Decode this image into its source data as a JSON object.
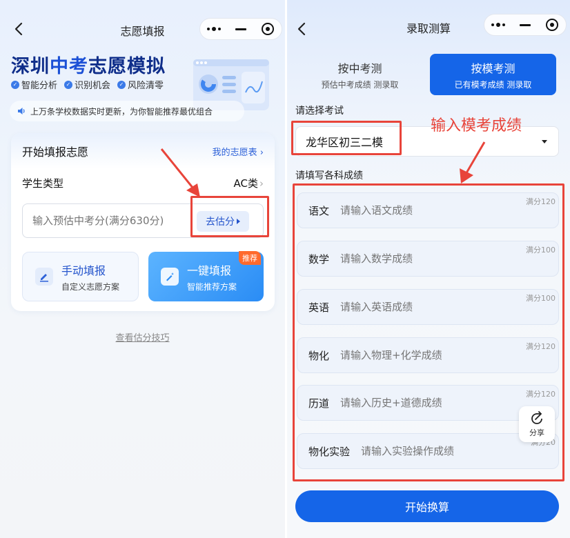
{
  "left": {
    "nav_title": "志愿填报",
    "hero": {
      "title_a": "深圳",
      "title_b": "中考",
      "title_c": "志愿模拟"
    },
    "features": [
      "智能分析",
      "识别机会",
      "风险清零"
    ],
    "notice": "上万条学校数据实时更新，为你智能推荐最优组合",
    "card": {
      "title": "开始填报志愿",
      "my_link": "我的志愿表",
      "student_type_label": "学生类型",
      "student_type_value": "AC类",
      "score_placeholder": "输入预估中考分(满分630分)",
      "estimate_button": "去估分",
      "manual": {
        "title": "手动填报",
        "subtitle": "自定义志愿方案"
      },
      "oneclick": {
        "title": "一键填报",
        "subtitle": "智能推荐方案",
        "tag": "推荐"
      }
    },
    "tips_link": "查看估分技巧"
  },
  "right": {
    "nav_title": "录取测算",
    "tabs": [
      {
        "main": "按中考测",
        "sub": "预估中考成绩 测录取"
      },
      {
        "main": "按模考测",
        "sub": "已有模考成绩 测录取"
      }
    ],
    "exam_label": "请选择考试",
    "exam_value": "龙华区初三二模",
    "subjects_label": "请填写各科成绩",
    "subjects": [
      {
        "name": "语文",
        "placeholder": "请输入语文成绩",
        "full": "满分120"
      },
      {
        "name": "数学",
        "placeholder": "请输入数学成绩",
        "full": "满分100"
      },
      {
        "name": "英语",
        "placeholder": "请输入英语成绩",
        "full": "满分100"
      },
      {
        "name": "物化",
        "placeholder": "请输入物理+化学成绩",
        "full": "满分120"
      },
      {
        "name": "历道",
        "placeholder": "请输入历史+道德成绩",
        "full": "满分120"
      },
      {
        "name": "物化实验",
        "placeholder": "请输入实验操作成绩",
        "full": "满分20"
      }
    ],
    "share_label": "分享",
    "start_button": "开始换算",
    "annotation": "输入模考成绩"
  },
  "colors": {
    "primary": "#1565e8",
    "brand_dark": "#0f2e8a",
    "annotation_red": "#e8443a",
    "recommend_tag": "#ff6a2c"
  },
  "icons": [
    "chevron-left-icon",
    "more-dots-icon",
    "minimize-icon",
    "target-icon",
    "check-badge-icon",
    "speaker-icon",
    "pencil-icon",
    "magic-pen-icon",
    "share-icon",
    "dropdown-triangle-icon"
  ]
}
